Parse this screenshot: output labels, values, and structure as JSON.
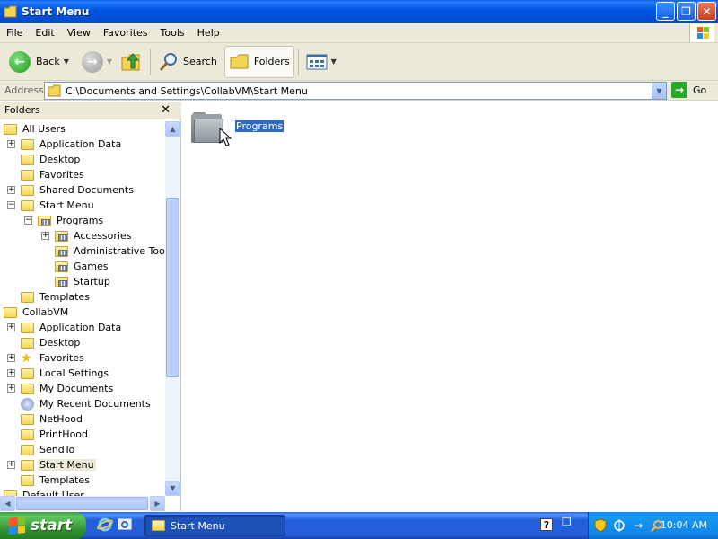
{
  "window": {
    "title": "Start Menu",
    "buttons": {
      "minimize": "_",
      "maximize": "❐",
      "close": "✕"
    }
  },
  "menu": [
    "File",
    "Edit",
    "View",
    "Favorites",
    "Tools",
    "Help"
  ],
  "toolbar": {
    "back_label": "Back",
    "search_label": "Search",
    "folders_label": "Folders"
  },
  "address": {
    "label": "Address",
    "path": "C:\\Documents and Settings\\CollabVM\\Start Menu",
    "go_label": "Go"
  },
  "folders_pane": {
    "title": "Folders",
    "close": "✕",
    "tree": [
      {
        "label": "All Users",
        "level": 0,
        "icon": "folder-icon",
        "expander": ""
      },
      {
        "label": "Application Data",
        "level": 1,
        "icon": "folder-icon",
        "expander": "+"
      },
      {
        "label": "Desktop",
        "level": 1,
        "icon": "folder-icon",
        "expander": ""
      },
      {
        "label": "Favorites",
        "level": 1,
        "icon": "folder-icon",
        "expander": ""
      },
      {
        "label": "Shared Documents",
        "level": 1,
        "icon": "folder-icon",
        "expander": "+"
      },
      {
        "label": "Start Menu",
        "level": 1,
        "icon": "folder-icon",
        "expander": "−"
      },
      {
        "label": "Programs",
        "level": 2,
        "icon": "programs-folder-icon",
        "expander": "−"
      },
      {
        "label": "Accessories",
        "level": 3,
        "icon": "programs-folder-icon",
        "expander": "+"
      },
      {
        "label": "Administrative Tools",
        "level": 3,
        "icon": "programs-folder-icon",
        "expander": ""
      },
      {
        "label": "Games",
        "level": 3,
        "icon": "programs-folder-icon",
        "expander": ""
      },
      {
        "label": "Startup",
        "level": 3,
        "icon": "programs-folder-icon",
        "expander": ""
      },
      {
        "label": "Templates",
        "level": 1,
        "icon": "folder-icon",
        "expander": ""
      },
      {
        "label": "CollabVM",
        "level": 0,
        "icon": "folder-icon",
        "expander": ""
      },
      {
        "label": "Application Data",
        "level": 1,
        "icon": "folder-icon",
        "expander": "+"
      },
      {
        "label": "Desktop",
        "level": 1,
        "icon": "folder-icon",
        "expander": ""
      },
      {
        "label": "Favorites",
        "level": 1,
        "icon": "favorites-star-icon",
        "expander": "+"
      },
      {
        "label": "Local Settings",
        "level": 1,
        "icon": "folder-icon",
        "expander": "+"
      },
      {
        "label": "My Documents",
        "level": 1,
        "icon": "folder-icon",
        "expander": "+"
      },
      {
        "label": "My Recent Documents",
        "level": 1,
        "icon": "recent-documents-icon",
        "expander": ""
      },
      {
        "label": "NetHood",
        "level": 1,
        "icon": "folder-icon",
        "expander": ""
      },
      {
        "label": "PrintHood",
        "level": 1,
        "icon": "folder-icon",
        "expander": ""
      },
      {
        "label": "SendTo",
        "level": 1,
        "icon": "folder-icon",
        "expander": ""
      },
      {
        "label": "Start Menu",
        "level": 1,
        "icon": "folder-icon",
        "expander": "+",
        "selected": true
      },
      {
        "label": "Templates",
        "level": 1,
        "icon": "folder-icon",
        "expander": ""
      },
      {
        "label": "Default User",
        "level": 0,
        "icon": "folder-icon",
        "expander": ""
      }
    ]
  },
  "content": {
    "items": [
      {
        "label": "Programs",
        "icon": "programs-folder-icon",
        "selected": true
      }
    ]
  },
  "taskbar": {
    "start_label": "start",
    "task_label": "Start Menu",
    "clock": "10:04 AM"
  },
  "colors": {
    "titlebar": "#0058e6",
    "selection": "#316ac5",
    "taskbar": "#245edb",
    "start": "#2f8f2f"
  }
}
